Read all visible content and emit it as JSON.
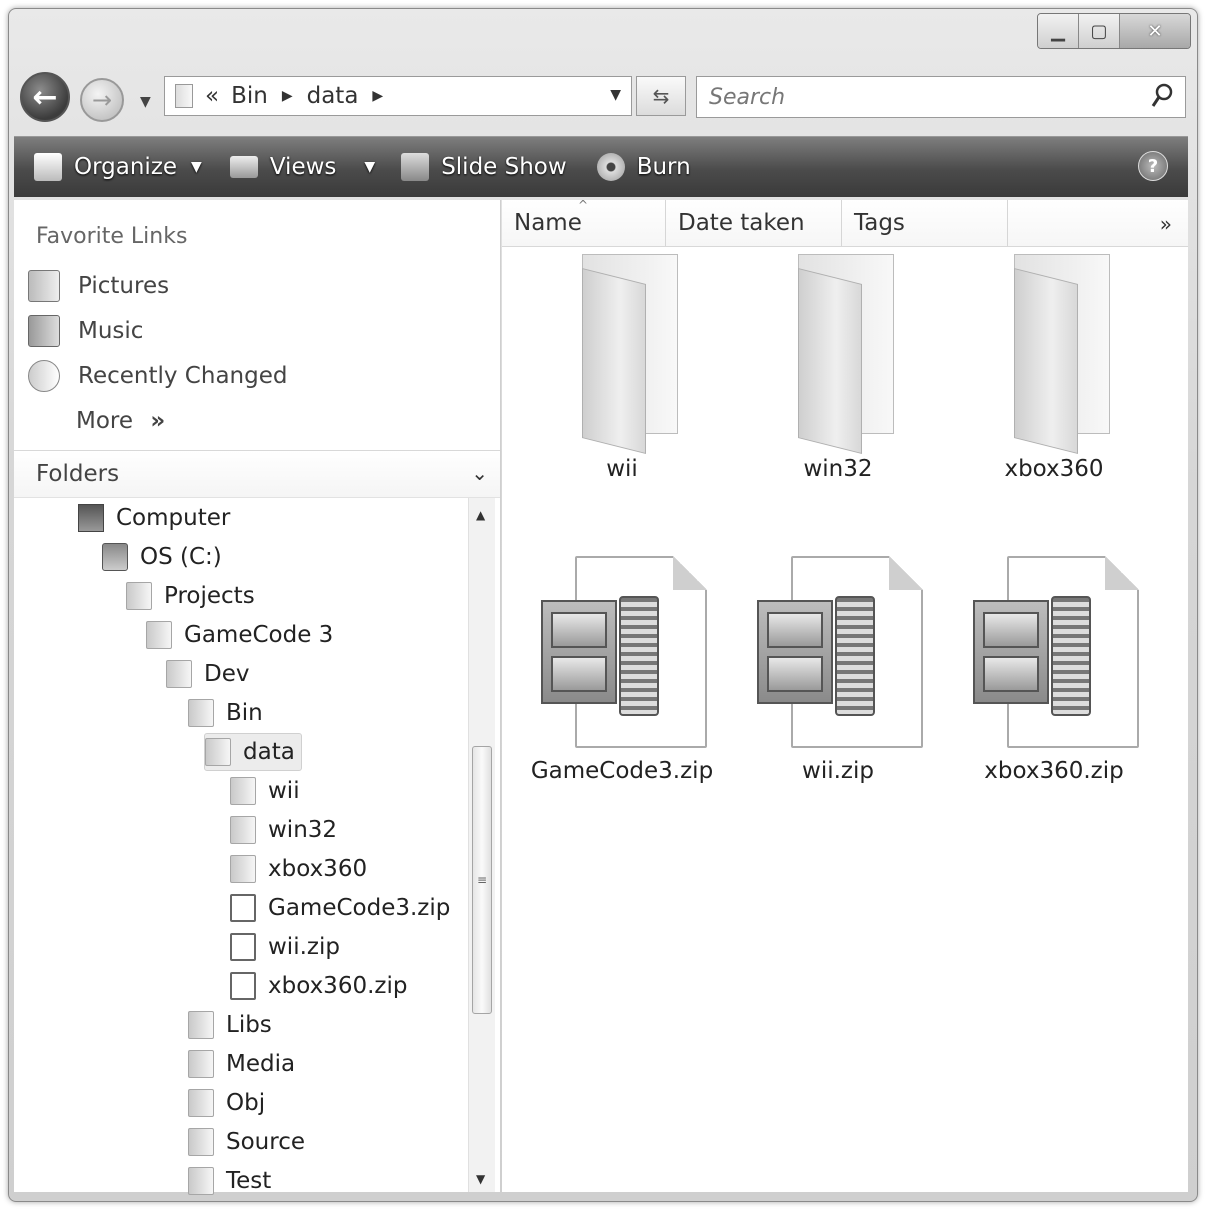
{
  "address": {
    "overflow": "«",
    "crumbs": [
      "Bin",
      "data"
    ]
  },
  "search": {
    "placeholder": "Search"
  },
  "toolbar": {
    "organize": "Organize",
    "views": "Views",
    "slideshow": "Slide Show",
    "burn": "Burn",
    "help": "?"
  },
  "favorites": {
    "title": "Favorite Links",
    "items": [
      "Pictures",
      "Music",
      "Recently Changed"
    ],
    "more": "More",
    "more_icon": "»"
  },
  "folders": {
    "label": "Folders",
    "tree": [
      {
        "label": "Computer",
        "icon": "computer-icon"
      },
      {
        "label": "OS (C:)",
        "icon": "drive-icon"
      },
      {
        "label": "Projects",
        "icon": "folder-icon"
      },
      {
        "label": "GameCode 3",
        "icon": "folder-icon"
      },
      {
        "label": "Dev",
        "icon": "folder-icon"
      },
      {
        "label": "Bin",
        "icon": "folder-icon"
      },
      {
        "label": "data",
        "icon": "folder-icon",
        "selected": true
      },
      {
        "label": "wii",
        "icon": "folder-icon"
      },
      {
        "label": "win32",
        "icon": "folder-icon"
      },
      {
        "label": "xbox360",
        "icon": "folder-icon"
      },
      {
        "label": "GameCode3.zip",
        "icon": "zip-icon"
      },
      {
        "label": "wii.zip",
        "icon": "zip-icon"
      },
      {
        "label": "xbox360.zip",
        "icon": "zip-icon"
      },
      {
        "label": "Libs",
        "icon": "folder-icon"
      },
      {
        "label": "Media",
        "icon": "folder-icon"
      },
      {
        "label": "Obj",
        "icon": "folder-icon"
      },
      {
        "label": "Source",
        "icon": "folder-icon"
      },
      {
        "label": "Test",
        "icon": "folder-icon"
      }
    ]
  },
  "columns": [
    "Name",
    "Date taken",
    "Tags"
  ],
  "columns_more": "»",
  "files": [
    {
      "label": "wii",
      "type": "folder"
    },
    {
      "label": "win32",
      "type": "folder"
    },
    {
      "label": "xbox360",
      "type": "folder"
    },
    {
      "label": "GameCode3.zip",
      "type": "zip"
    },
    {
      "label": "wii.zip",
      "type": "zip"
    },
    {
      "label": "xbox360.zip",
      "type": "zip"
    }
  ]
}
